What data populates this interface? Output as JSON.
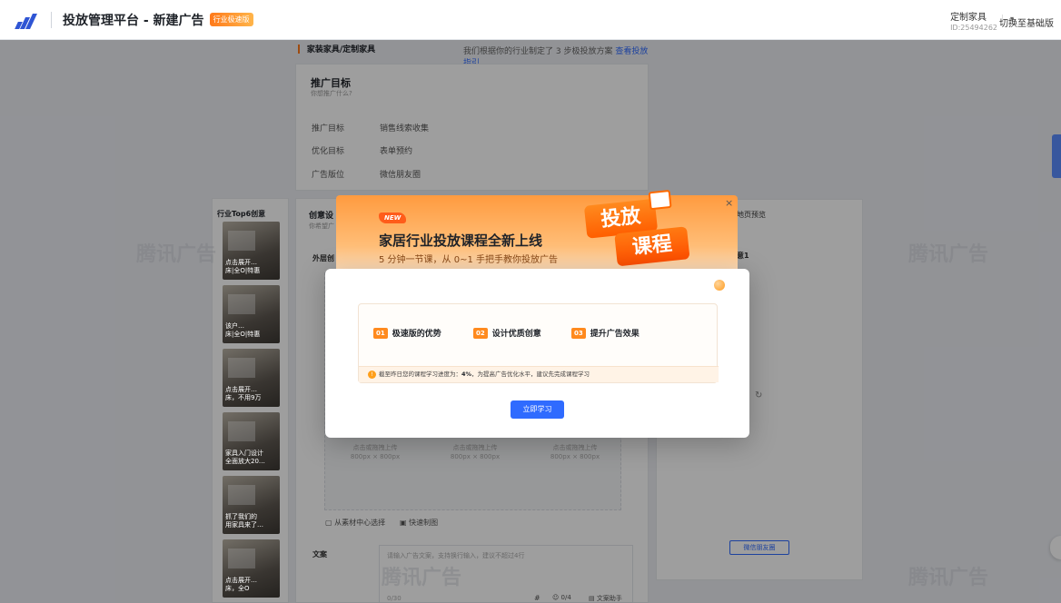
{
  "header": {
    "app_title": "投放管理平台 - 新建广告",
    "speed_badge": "行业极速版",
    "account_name": "定制家具",
    "account_id": "ID:25494262",
    "switch_label": "切换至基础版"
  },
  "breadcrumb": {
    "path": "家装家具/定制家具",
    "hint": "我们根据你的行业制定了 3 步极投放方案 ",
    "guide_link": "查看投放指引"
  },
  "promo_target": {
    "title": "推广目标",
    "subtitle": "你想推广什么?",
    "rows": [
      {
        "label": "推广目标",
        "value": "销售线索收集"
      },
      {
        "label": "优化目标",
        "value": "表单预约"
      },
      {
        "label": "广告版位",
        "value": "微信朋友圈"
      }
    ]
  },
  "top6": {
    "title": "行业Top6创意",
    "items": [
      {
        "caption": "点击展开…\n床|全O|特惠"
      },
      {
        "caption": "该户…\n床|全O|特惠"
      },
      {
        "caption": "点击展开…\n床，不用9万"
      },
      {
        "caption": "家具入门设计\n全面放大20…"
      },
      {
        "caption": "抓了我们的\n用家具来了…"
      },
      {
        "caption": "点击展开…\n床，全O"
      }
    ]
  },
  "creative": {
    "title": "创意设",
    "subtitle": "你希望广",
    "outer_label": "外层创",
    "upload_text": "点击或拖拽上传",
    "upload_size": "800px × 800px",
    "from_library": "从素材中心选择",
    "quick_make": "快速制图",
    "copy_label": "文案",
    "copy_placeholder": "请输入广告文案，支持换行输入，建议不超过4行",
    "copy_count": "0/30",
    "emoji_count": "0/4",
    "copy_helper": "文案助手"
  },
  "preview": {
    "title": "地页预览",
    "item": "意1",
    "button": "微信朋友圈"
  },
  "watermark": "腾讯广告",
  "modal": {
    "badge": "NEW",
    "title": "家居行业投放课程全新上线",
    "subtitle": "5 分钟一节课，从 0~1 手把手教你投放广告",
    "sign_line1": "投放",
    "sign_line2": "课程",
    "items": [
      {
        "num": "01",
        "label": "极速版的优势"
      },
      {
        "num": "02",
        "label": "设计优质创意"
      },
      {
        "num": "03",
        "label": "提升广告效果"
      }
    ],
    "progress_prefix": "截至昨日您的课程学习进度为：",
    "progress_value": "4%",
    "progress_suffix": "，为提高广告优化水平，建议先完成课程学习",
    "cta": "立即学习",
    "close": "×"
  }
}
